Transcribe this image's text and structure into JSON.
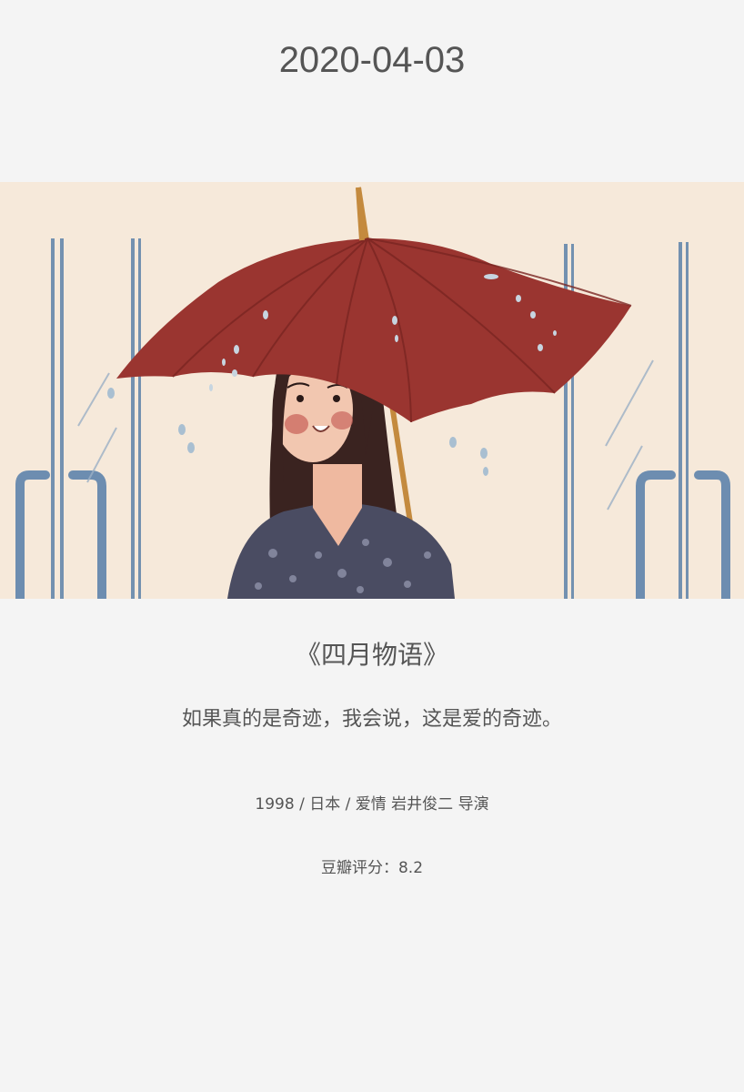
{
  "date": "2020-04-03",
  "poster": {
    "image": "illustration-girl-red-umbrella",
    "colors": {
      "background": "#f6e9da",
      "umbrella": "#9a3530",
      "rails": "#6f8fae",
      "hair": "#3a2320",
      "shirt": "#4a4c62"
    }
  },
  "movie": {
    "title": "《四月物语》",
    "quote": "如果真的是奇迹，我会说，这是爱的奇迹。",
    "meta": "1998 / 日本 / 爱情 岩井俊二 导演",
    "rating": "豆瓣评分：8.2"
  }
}
